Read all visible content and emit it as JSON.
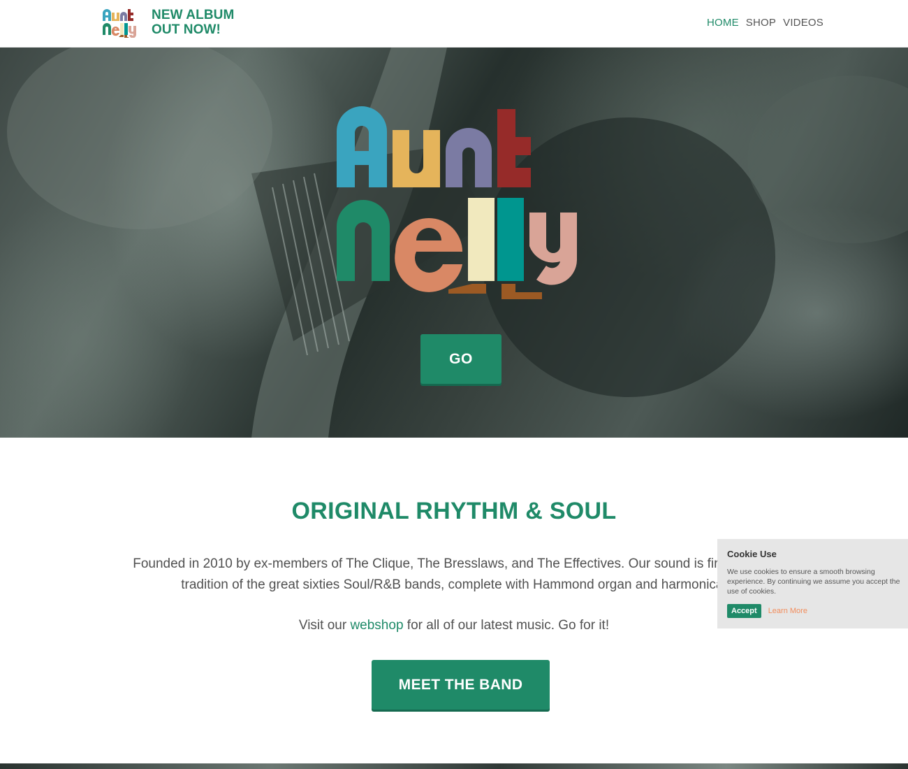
{
  "header": {
    "logo_alt": "Aunt Nelly",
    "tagline_line1": "NEW ALBUM",
    "tagline_line2": "OUT NOW!",
    "nav": [
      {
        "label": "HOME",
        "active": true
      },
      {
        "label": "SHOP",
        "active": false
      },
      {
        "label": "VIDEOS",
        "active": false
      }
    ]
  },
  "hero": {
    "logo_alt": "Aunt Nelly",
    "cta_label": "GO"
  },
  "intro": {
    "heading": "ORIGINAL RHYTHM & SOUL",
    "paragraph1": "Founded in 2010 by ex-members of The Clique, The Bresslaws, and The Effectives. Our sound is firmly in the tradition of the great sixties Soul/R&B bands, complete with Hammond organ and harmonica.",
    "paragraph2_before": "Visit our ",
    "paragraph2_link": "webshop",
    "paragraph2_after": " for all of our latest music. Go for it!",
    "button_label": "MEET THE BAND"
  },
  "cookie": {
    "title": "Cookie Use",
    "message": "We use cookies to ensure a smooth browsing experience. By continuing we assume you accept the use of cookies.",
    "accept_label": "Accept",
    "learn_more_label": "Learn More"
  },
  "colors": {
    "accent_green": "#1f8a68",
    "logo_blue": "#3aa4bf",
    "logo_yellow": "#e5b45b",
    "logo_purple": "#7b7ba3",
    "logo_red": "#962b29",
    "logo_green": "#1f8a68",
    "logo_orange": "#d98865",
    "logo_cream": "#f1e9be",
    "logo_teal": "#00968f",
    "logo_pink": "#d9a497",
    "logo_shoes": "#9c5a24",
    "cookie_link": "#f28c5b"
  }
}
